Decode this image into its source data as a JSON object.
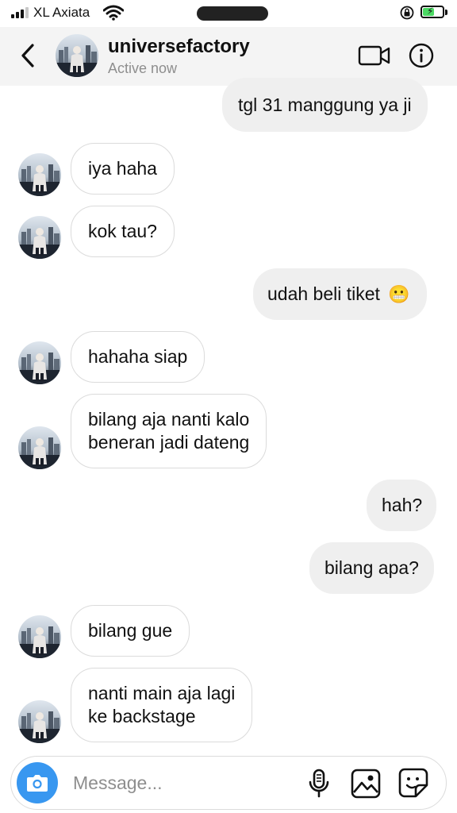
{
  "status_bar": {
    "carrier": "XL Axiata",
    "battery_level": 0.6,
    "battery_color": "#4cd964"
  },
  "header": {
    "username": "universefactory",
    "presence": "Active now",
    "back_icon": "chevron-left-icon",
    "video_icon": "video-camera-icon",
    "info_icon": "info-icon"
  },
  "messages": [
    {
      "direction": "outgoing",
      "text": "tgl 31 manggung ya ji"
    },
    {
      "direction": "incoming",
      "text": "iya haha"
    },
    {
      "direction": "incoming",
      "text": "kok tau?"
    },
    {
      "direction": "outgoing",
      "text": "udah beli tiket",
      "emoji": "😬"
    },
    {
      "direction": "incoming",
      "text": "hahaha siap"
    },
    {
      "direction": "incoming",
      "lines": [
        "bilang aja nanti kalo",
        "beneran jadi dateng"
      ]
    },
    {
      "direction": "outgoing",
      "text": "hah?"
    },
    {
      "direction": "outgoing",
      "text": "bilang apa?"
    },
    {
      "direction": "incoming",
      "text": "bilang gue"
    },
    {
      "direction": "incoming",
      "lines": [
        "nanti main aja lagi",
        "ke backstage"
      ]
    }
  ],
  "composer": {
    "placeholder": "Message...",
    "value": "",
    "accent_color": "#3897f0"
  },
  "colors": {
    "outgoing_bubble": "#efefef",
    "incoming_border": "#dbdbdb",
    "header_bg": "#f4f4f4",
    "secondary_text": "#8e8e8e"
  }
}
